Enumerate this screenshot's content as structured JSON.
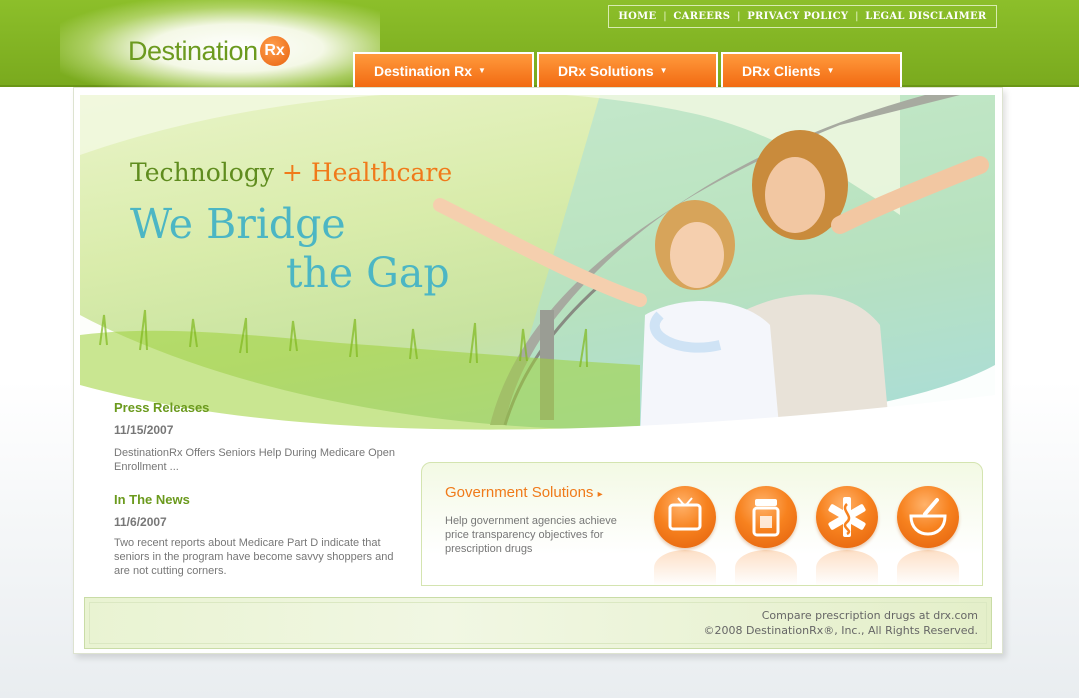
{
  "brand": {
    "name": "Destination",
    "rx": "Rx"
  },
  "top_links": [
    "HOME",
    "CAREERS",
    "PRIVACY POLICY",
    "LEGAL DISCLAIMER"
  ],
  "top_links_sep": "|",
  "nav": [
    {
      "label": "Destination Rx",
      "caret": "▼"
    },
    {
      "label": "DRx Solutions",
      "caret": "▼"
    },
    {
      "label": "DRx Clients",
      "caret": "▼"
    }
  ],
  "hero": {
    "tech": "Technology",
    "plus": "+",
    "healthcare": "Healthcare",
    "line2": "We Bridge",
    "line3": "the Gap"
  },
  "news": {
    "press_title": "Press Releases",
    "press_date": "11/15/2007",
    "press_text": "DestinationRx Offers Seniors Help During Medicare Open Enrollment ...",
    "news_title": "In The News",
    "news_date": "11/6/2007",
    "news_text": "Two recent reports about Medicare Part D indicate that seniors in the program have become savvy shoppers and are not cutting corners."
  },
  "gov": {
    "title": "Government Solutions",
    "arrow": "▸",
    "text": "Help government agencies achieve price transparency objectives for prescription drugs",
    "icons": [
      "tv-icon",
      "pill-bottle-icon",
      "medical-star-icon",
      "mortar-pestle-icon"
    ]
  },
  "footer": {
    "line1": "Compare prescription drugs at drx.com",
    "line2": "©2008 DestinationRx®, Inc., All Rights Reserved."
  },
  "colors": {
    "header_green": "#8cbf2a",
    "nav_orange": "#f26a12",
    "accent_teal": "#4cb6c4",
    "accent_green": "#6b9a1d"
  }
}
